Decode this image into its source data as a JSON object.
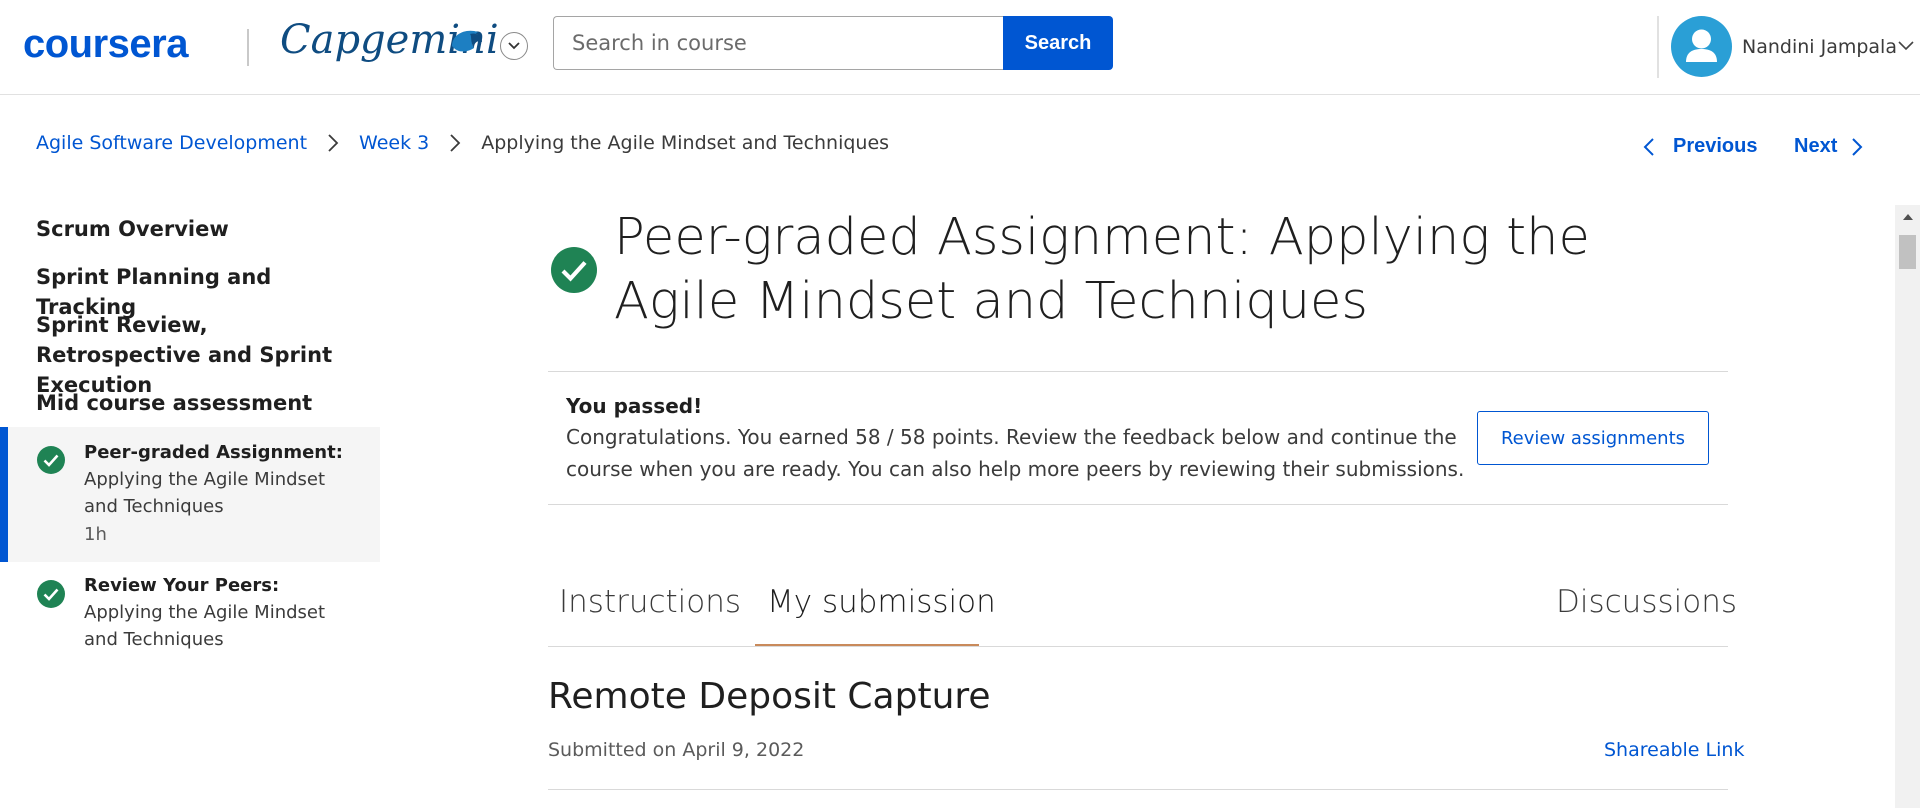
{
  "header": {
    "logo": "coursera",
    "partner_logo": "Capgemini",
    "search_placeholder": "Search in course",
    "search_button": "Search",
    "user_name": "Nandini Jampala"
  },
  "breadcrumb": {
    "course": "Agile Software Development",
    "week": "Week 3",
    "current": "Applying the Agile Mindset and Techniques"
  },
  "nav": {
    "previous": "Previous",
    "next": "Next"
  },
  "sidebar": {
    "sections": [
      "Scrum Overview",
      "Sprint Planning and Tracking",
      "Sprint Review, Retrospective and Sprint Execution",
      "Mid course assessment"
    ],
    "items": [
      {
        "type": "Peer-graded Assignment:",
        "name": "Applying the Agile Mindset and Techniques",
        "duration": "1h",
        "status": "completed",
        "active": true
      },
      {
        "type": "Review Your Peers:",
        "name": "Applying the Agile Mindset and Techniques",
        "status": "completed",
        "active": false
      }
    ]
  },
  "main": {
    "title": "Peer-graded Assignment: Applying the Agile Mindset and Techniques",
    "result": {
      "heading": "You passed!",
      "message": "Congratulations. You earned 58 / 58 points. Review the feedback below and continue the course when you are ready. You can also help more peers by reviewing their submissions.",
      "button": "Review assignments"
    },
    "tabs": [
      {
        "label": "Instructions",
        "active": false
      },
      {
        "label": "My submission",
        "active": true
      },
      {
        "label": "Discussions",
        "active": false
      }
    ],
    "submission": {
      "title": "Remote Deposit Capture",
      "date": "Submitted on April 9, 2022",
      "share_link": "Shareable Link"
    }
  },
  "colors": {
    "brand_blue": "#0056d2",
    "success_green": "#1f8354",
    "tab_underline": "#c98a5b"
  }
}
